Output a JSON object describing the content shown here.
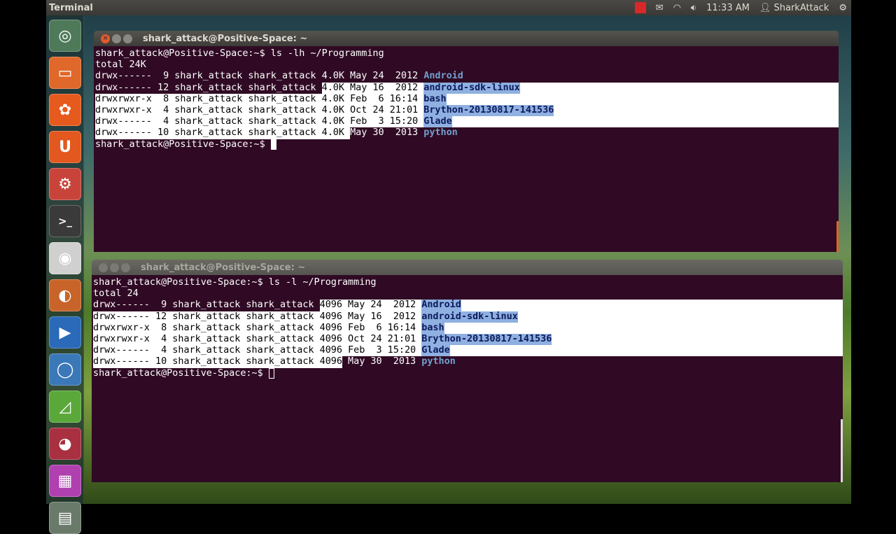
{
  "panel": {
    "app_name": "Terminal",
    "time": "11:33 AM",
    "user": "SharkAttack",
    "icons": [
      "record-icon",
      "mail-icon",
      "wifi-icon",
      "volume-icon",
      "user-icon",
      "gear-icon"
    ]
  },
  "launcher": [
    "dash-icon",
    "files-icon",
    "software-center-icon",
    "ubuntu-one-icon",
    "system-settings-icon",
    "terminal-icon",
    "camera-icon",
    "firefox-icon",
    "media-player-icon",
    "chromium-icon",
    "geometry-icon",
    "app-icon",
    "video-editor-icon",
    "trash-icon"
  ],
  "colors": {
    "terminal_bg": "#300a24",
    "dir": "#729fcf",
    "selection": "#ffffff",
    "dir_selection": "#8fb0e0"
  },
  "terminals": [
    {
      "title": "shark_attack@Positive-Space: ~",
      "lines": [
        {
          "segs": [
            {
              "t": "shark_attack@Positive-Space:~$ ls -lh ~/Programming",
              "k": "n"
            }
          ]
        },
        {
          "segs": [
            {
              "t": "total 24K",
              "k": "n"
            }
          ]
        },
        {
          "segs": [
            {
              "t": "drwx------  9 shark_attack shark_attack 4.0K May 24  2012 ",
              "k": "n"
            },
            {
              "t": "Android",
              "k": "d"
            }
          ]
        },
        {
          "fill": true,
          "segs": [
            {
              "t": "drwx------ 12 shark_attack shark_attack ",
              "k": "n"
            },
            {
              "t": "4.0K May 16  2012 ",
              "k": "s"
            },
            {
              "t": "android-sdk-linux",
              "k": "sd"
            }
          ]
        },
        {
          "fill": true,
          "segs": [
            {
              "t": "drwxrwxr-x  8 shark_attack shark_attack 4.0K Feb  6 16:14 ",
              "k": "s"
            },
            {
              "t": "bash",
              "k": "sd"
            }
          ]
        },
        {
          "fill": true,
          "segs": [
            {
              "t": "drwxrwxr-x  4 shark_attack shark_attack 4.0K Oct 24 21:01 ",
              "k": "s"
            },
            {
              "t": "Brython-20130817-141536",
              "k": "sd"
            }
          ]
        },
        {
          "fill": true,
          "segs": [
            {
              "t": "drwx------  4 shark_attack shark_attack 4.0K Feb  3 15:20 ",
              "k": "s"
            },
            {
              "t": "Glade",
              "k": "sd"
            }
          ]
        },
        {
          "segs": [
            {
              "t": "drwx------ 10 shark_attack shark_attack 4.0K ",
              "k": "s"
            },
            {
              "t": "May 30  2013 ",
              "k": "n"
            },
            {
              "t": "python",
              "k": "d"
            }
          ]
        },
        {
          "prompt": true,
          "segs": [
            {
              "t": "shark_attack@Positive-Space:~$",
              "k": "n"
            }
          ]
        }
      ]
    },
    {
      "title": "shark_attack@Positive-Space: ~",
      "lines": [
        {
          "segs": [
            {
              "t": "shark_attack@Positive-Space:~$ ls -l ~/Programming",
              "k": "n"
            }
          ]
        },
        {
          "segs": [
            {
              "t": "total 24",
              "k": "n"
            }
          ]
        },
        {
          "fill": true,
          "segs": [
            {
              "t": "drwx------  9 shark_attack shark_attack ",
              "k": "n"
            },
            {
              "t": "4096 May 24  2012 ",
              "k": "s"
            },
            {
              "t": "Android",
              "k": "sd"
            }
          ]
        },
        {
          "fill": true,
          "segs": [
            {
              "t": "drwx------ 12 shark_attack shark_attack 4096 May 16  2012 ",
              "k": "s"
            },
            {
              "t": "android-sdk-linux",
              "k": "sd"
            }
          ]
        },
        {
          "fill": true,
          "segs": [
            {
              "t": "drwxrwxr-x  8 shark_attack shark_attack 4096 Feb  6 16:14 ",
              "k": "s"
            },
            {
              "t": "bash",
              "k": "sd"
            }
          ]
        },
        {
          "fill": true,
          "segs": [
            {
              "t": "drwxrwxr-x  4 shark_attack shark_attack 4096 Oct 24 21:01 ",
              "k": "s"
            },
            {
              "t": "Brython-20130817-141536",
              "k": "sd"
            }
          ]
        },
        {
          "fill": true,
          "segs": [
            {
              "t": "drwx------  4 shark_attack shark_attack 4096 Feb  3 15:20 ",
              "k": "s"
            },
            {
              "t": "Glade",
              "k": "sd"
            }
          ]
        },
        {
          "segs": [
            {
              "t": "drwx------ 10 shark_attack shark_attack 4096",
              "k": "s"
            },
            {
              "t": " May 30  2013 ",
              "k": "n"
            },
            {
              "t": "python",
              "k": "d"
            }
          ]
        },
        {
          "prompt": true,
          "segs": [
            {
              "t": "shark_attack@Positive-Space:~$",
              "k": "n"
            }
          ]
        }
      ]
    }
  ]
}
